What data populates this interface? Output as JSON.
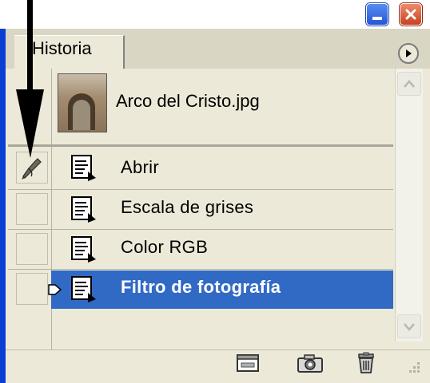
{
  "panel": {
    "tab_label": "Historia"
  },
  "snapshot": {
    "label": "Arco del Cristo.jpg"
  },
  "states": [
    {
      "label": "Abrir",
      "selected": false,
      "has_brush": true
    },
    {
      "label": "Escala de grises",
      "selected": false,
      "has_brush": false
    },
    {
      "label": "Color RGB",
      "selected": false,
      "has_brush": false
    },
    {
      "label": "Filtro de fotografía",
      "selected": true,
      "has_brush": false
    }
  ],
  "colors": {
    "selection": "#316ac5",
    "window_border": "#0a3fd6",
    "panel_bg": "#ece9d8"
  },
  "icons": {
    "window_minimize": "minimize-icon",
    "window_close": "close-icon",
    "panel_menu": "panel-menu-arrow-icon",
    "history_brush": "history-brush-icon",
    "state_document": "history-state-icon",
    "new_document": "new-document-from-state-icon",
    "snapshot": "camera-snapshot-icon",
    "delete": "trash-icon"
  }
}
